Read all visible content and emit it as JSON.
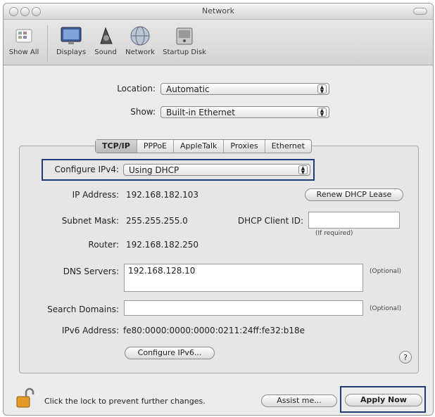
{
  "window": {
    "title": "Network"
  },
  "toolbar": {
    "items": [
      {
        "label": "Show All",
        "icon": "show-all-icon"
      },
      {
        "label": "Displays",
        "icon": "displays-icon"
      },
      {
        "label": "Sound",
        "icon": "sound-icon"
      },
      {
        "label": "Network",
        "icon": "network-icon"
      },
      {
        "label": "Startup Disk",
        "icon": "startup-disk-icon"
      }
    ]
  },
  "location": {
    "label": "Location:",
    "value": "Automatic"
  },
  "show": {
    "label": "Show:",
    "value": "Built-in Ethernet"
  },
  "tabs": [
    "TCP/IP",
    "PPPoE",
    "AppleTalk",
    "Proxies",
    "Ethernet"
  ],
  "tcpip": {
    "configure": {
      "label": "Configure IPv4:",
      "value": "Using DHCP"
    },
    "ip_address": {
      "label": "IP Address:",
      "value": "192.168.182.103"
    },
    "renew_label": "Renew DHCP Lease",
    "subnet": {
      "label": "Subnet Mask:",
      "value": "255.255.255.0"
    },
    "dhcp_client": {
      "label": "DHCP Client ID:",
      "value": "",
      "hint": "(If required)"
    },
    "router": {
      "label": "Router:",
      "value": "192.168.182.250"
    },
    "dns": {
      "label": "DNS Servers:",
      "value": "192.168.128.10",
      "note": "(Optional)"
    },
    "search": {
      "label": "Search Domains:",
      "value": "",
      "note": "(Optional)"
    },
    "ipv6": {
      "label": "IPv6 Address:",
      "value": "fe80:0000:0000:0000:0211:24ff:fe32:b18e"
    },
    "configure_ipv6_label": "Configure IPv6...",
    "help_label": "?"
  },
  "footer": {
    "lock_text": "Click the lock to prevent further changes.",
    "assist_label": "Assist me...",
    "apply_label": "Apply Now"
  },
  "colors": {
    "highlight": "#1f3c7a"
  }
}
